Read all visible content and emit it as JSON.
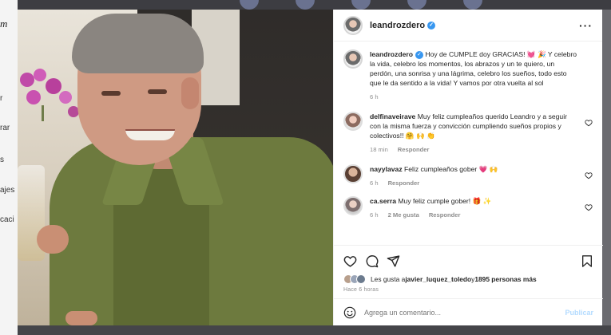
{
  "background": {
    "logo_fragment": "m",
    "nav_fragments": [
      "r",
      "rar",
      "s",
      "ajes",
      "caci"
    ]
  },
  "post": {
    "username": "leandrozdero",
    "caption_text": "Hoy de CUMPLE doy GRACIAS! 💓 🎉 Y celebro la vida, celebro los momentos, los abrazos y un te quiero, un perdón, una sonrisa y una lágrima, celebro los sueños, todo esto que le da sentido a la vida! Y vamos por otra vuelta al sol",
    "caption_time": "6 h",
    "more_icon": "more-horizontal-icon"
  },
  "comments": [
    {
      "user": "delfinaveirave",
      "text": "Muy feliz cumpleaños querido Leandro y a seguir con la misma fuerza y convicción cumpliendo sueños propios y colectivos!! 🤗 🙌 👏",
      "time": "18 min",
      "reply": "Responder",
      "likes": ""
    },
    {
      "user": "nayylavaz",
      "text": "Feliz cumpleaños gober 💗 🙌",
      "time": "6 h",
      "reply": "Responder",
      "likes": ""
    },
    {
      "user": "ca.serra",
      "text": "Muy feliz cumple gober! 🎁 ✨",
      "time": "6 h",
      "reply": "Responder",
      "likes": "2 Me gusta"
    }
  ],
  "likes": {
    "prefix": "Les gusta a ",
    "user": "javier_luquez_toledo",
    "middle": " y ",
    "count": "1895 personas más"
  },
  "timestamp": "Hace 6 horas",
  "add_comment": {
    "placeholder": "Agrega un comentario...",
    "publish": "Publicar"
  },
  "colors": {
    "verified": "#3897f0",
    "publish_disabled": "#b3dbff",
    "muted_text": "#8e8e8e",
    "primary_text": "#262626"
  }
}
